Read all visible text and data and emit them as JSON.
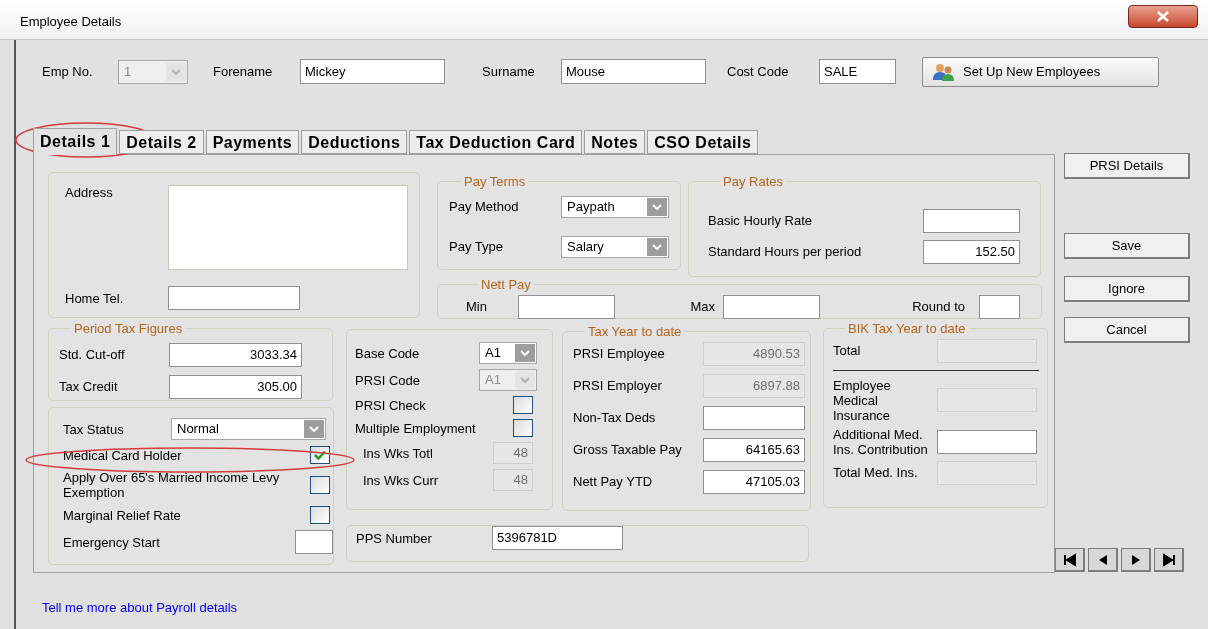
{
  "window": {
    "title": "Employee Details"
  },
  "header_fields": [
    {
      "label": "Emp No.",
      "kind": "select",
      "value": "1",
      "disabled": true
    },
    {
      "label": "Forename",
      "kind": "text",
      "value": "Mickey",
      "disabled": false
    },
    {
      "label": "Surname",
      "kind": "text",
      "value": "Mouse",
      "disabled": false
    },
    {
      "label": "Cost Code",
      "kind": "text",
      "value": "SALE",
      "disabled": false
    }
  ],
  "setup_button": "Set Up New Employees",
  "tabs": [
    {
      "label": "Details 1",
      "selected": true
    },
    {
      "label": "Details 2",
      "selected": false
    },
    {
      "label": "Payments",
      "selected": false
    },
    {
      "label": "Deductions",
      "selected": false
    },
    {
      "label": "Tax Deduction Card",
      "selected": false
    },
    {
      "label": "Notes",
      "selected": false
    },
    {
      "label": "CSO Details",
      "selected": false
    }
  ],
  "address": {
    "fields": [
      {
        "label": "Address",
        "kind": "textarea",
        "disabled": false
      },
      {
        "label": "Home Tel.",
        "kind": "text",
        "disabled": false
      }
    ]
  },
  "pay_terms": {
    "title": "Pay Terms",
    "fields": [
      {
        "label": "Pay Method",
        "kind": "select",
        "value": "Paypath",
        "disabled": false
      },
      {
        "label": "Pay Type",
        "kind": "select",
        "value": "Salary",
        "disabled": false
      }
    ]
  },
  "pay_rates": {
    "title": "Pay Rates",
    "fields": [
      {
        "label": "Basic Hourly Rate",
        "kind": "text",
        "disabled": false
      },
      {
        "label": "Standard Hours per period",
        "kind": "text",
        "value": "152.50",
        "disabled": false
      }
    ]
  },
  "nett_pay": {
    "title": "Nett Pay",
    "fields": [
      {
        "label": "Min",
        "kind": "text",
        "disabled": false
      },
      {
        "label": "Max",
        "kind": "text",
        "disabled": false
      },
      {
        "label": "Round to",
        "kind": "text",
        "disabled": false
      }
    ]
  },
  "period_tax_figures": {
    "title": "Period Tax Figures",
    "fields": [
      {
        "label": "Std. Cut-off",
        "kind": "text",
        "value": "3033.34",
        "disabled": false
      },
      {
        "label": "Tax Credit",
        "kind": "text",
        "value": "305.00",
        "disabled": false
      }
    ]
  },
  "tax_status": {
    "fields": [
      {
        "label": "Tax Status",
        "kind": "select",
        "value": "Normal",
        "disabled": false
      },
      {
        "label": "Medical Card Holder",
        "kind": "checkbox",
        "checked": true,
        "disabled": false
      },
      {
        "label": "Apply Over 65's Married Income Levy Exemption",
        "kind": "checkbox",
        "checked": false,
        "disabled": false
      },
      {
        "label": "Marginal Relief Rate",
        "kind": "checkbox",
        "checked": false,
        "disabled": false
      },
      {
        "label": "Emergency Start",
        "kind": "text",
        "disabled": false
      }
    ]
  },
  "prsi": {
    "fields": [
      {
        "label": "Base Code",
        "kind": "select",
        "value": "A1",
        "disabled": false
      },
      {
        "label": "PRSI Code",
        "kind": "select",
        "value": "A1",
        "disabled": true
      },
      {
        "label": "PRSI Check",
        "kind": "checkbox",
        "checked": false,
        "disabled": false
      },
      {
        "label": "Multiple Employment",
        "kind": "checkbox",
        "checked": false,
        "disabled": false
      },
      {
        "label": "Ins Wks Totl",
        "kind": "text",
        "value": "48",
        "disabled": true
      },
      {
        "label": "Ins Wks Curr",
        "kind": "text",
        "value": "48",
        "disabled": true
      }
    ]
  },
  "pps": {
    "fields": [
      {
        "label": "PPS Number",
        "kind": "text",
        "value": "5396781D",
        "disabled": false
      }
    ]
  },
  "tax_year_to_date": {
    "title": "Tax Year to date",
    "fields": [
      {
        "label": "PRSI Employee",
        "kind": "text",
        "value": "4890.53",
        "disabled": true
      },
      {
        "label": "PRSI Employer",
        "kind": "text",
        "value": "6897.88",
        "disabled": true
      },
      {
        "label": "Non-Tax Deds",
        "kind": "text",
        "disabled": false
      },
      {
        "label": "Gross Taxable Pay",
        "kind": "text",
        "value": "64165.63",
        "disabled": false
      },
      {
        "label": "Nett Pay YTD",
        "kind": "text",
        "value": "47105.03",
        "disabled": false
      }
    ]
  },
  "bik_tax_year_to_date": {
    "title": "BIK Tax Year to date",
    "fields": [
      {
        "label": "Total",
        "kind": "text",
        "disabled": true
      },
      {
        "label": "Employee Medical Insurance",
        "kind": "text",
        "disabled": true
      },
      {
        "label": "Additional Med. Ins. Contribution",
        "kind": "text",
        "disabled": false
      },
      {
        "label": "Total Med. Ins.",
        "kind": "text",
        "disabled": true
      }
    ]
  },
  "side_buttons": [
    "PRSI Details",
    "Save",
    "Ignore",
    "Cancel"
  ],
  "help_link": "Tell me more about Payroll details"
}
